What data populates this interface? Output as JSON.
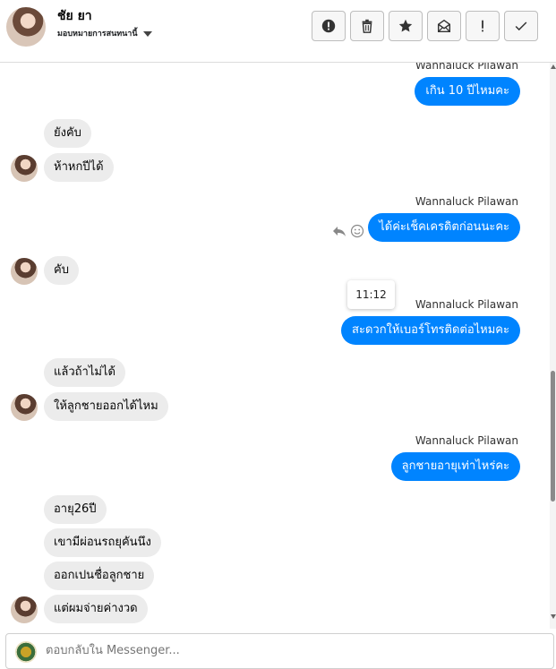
{
  "header": {
    "contact_name": "ชัย ยา",
    "assign_label": "มอบหมายการสนทนานี้",
    "toolbar": [
      {
        "name": "spam-button",
        "icon": "alert-circle-icon"
      },
      {
        "name": "delete-button",
        "icon": "trash-icon"
      },
      {
        "name": "star-button",
        "icon": "star-icon"
      },
      {
        "name": "mark-unread-button",
        "icon": "envelope-icon"
      },
      {
        "name": "important-button",
        "icon": "exclamation-icon"
      },
      {
        "name": "done-button",
        "icon": "check-icon"
      }
    ]
  },
  "thread": {
    "sender_name": "Wannaluck Pilawan",
    "messages": {
      "m1": "เกิน 10 ปีไหมคะ",
      "m2": "ยังคับ",
      "m3": "ห้าหกปีได้",
      "m4": "ได้ค่ะเช็คเครดิตก่อนนะคะ",
      "m5": "คับ",
      "m6": "สะดวกให้เบอร์โทรติดต่อไหมคะ",
      "m7": "แล้วถ้าไม่ได้",
      "m8": "ให้ลูกชายออกได้ไหม",
      "m9": "ลูกชายอายุเท่าไหร่คะ",
      "m10": "อายุ26ปี",
      "m11": "เขามีผ่อนรถยุคันนึง",
      "m12": "ออกเปนชื่อลูกชาย",
      "m13": "แต่ผมจ่ายค่างวด"
    },
    "tooltip_time": "11:12"
  },
  "composer": {
    "placeholder": "ตอบกลับใน Messenger..."
  },
  "colors": {
    "outgoing_bubble": "#0084ff",
    "incoming_bubble": "#ececec"
  }
}
